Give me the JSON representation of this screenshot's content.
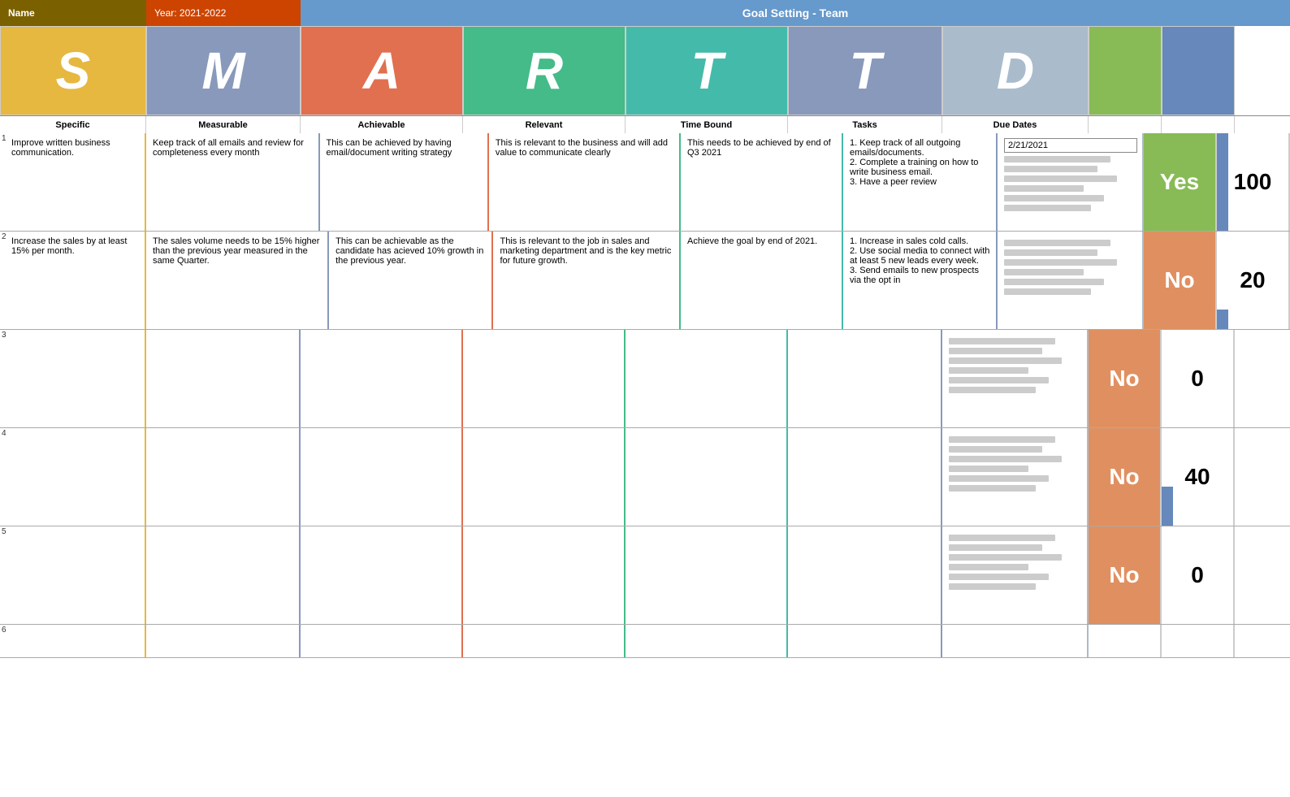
{
  "title": {
    "name_label": "Name",
    "year_label": "Year: 2021-2022",
    "main_title": "Goal Setting - Team"
  },
  "smart_letters": {
    "s": "S",
    "m": "M",
    "a": "A",
    "r": "R",
    "t1": "T",
    "t2": "T",
    "d": "D"
  },
  "col_labels": {
    "specific": "Specific",
    "measurable": "Measurable",
    "achievable": "Achievable",
    "relevant": "Relevant",
    "timebound": "Time Bound",
    "tasks": "Tasks",
    "duedates": "Due Dates",
    "yesno": "",
    "score": ""
  },
  "rows": [
    {
      "num": "1",
      "specific": "Improve written business communication.",
      "measurable": "Keep track of all emails and review for completeness every month",
      "achievable": "This can be achieved by having email/document writing strategy",
      "relevant": "This is relevant to the business and will add value to communicate clearly",
      "timebound": "This needs to be achieved by end of Q3 2021",
      "tasks": "1. Keep track of all outgoing emails/documents.\n2. Complete a training on how to write business email.\n3. Have a peer review",
      "due_date": "2/21/2021",
      "yesno": "Yes",
      "score": "100",
      "score_pct": 100
    },
    {
      "num": "2",
      "specific": "Increase the sales by at least 15% per month.",
      "measurable": "The sales volume needs to be 15% higher than the previous year measured in the same Quarter.",
      "achievable": "This can be achievable as the candidate has acieved 10% growth in the previous year.",
      "relevant": "This is relevant to the job in sales and marketing department and is the key metric for future growth.",
      "timebound": "Achieve the goal by end of 2021.",
      "tasks": "1. Increase in sales cold calls.\n2. Use social media to connect with at least 5 new leads every week.\n3. Send emails to new prospects via the opt in",
      "due_date": "",
      "yesno": "No",
      "score": "20",
      "score_pct": 20
    },
    {
      "num": "3",
      "specific": "",
      "measurable": "",
      "achievable": "",
      "relevant": "",
      "timebound": "",
      "tasks": "",
      "due_date": "",
      "yesno": "No",
      "score": "0",
      "score_pct": 0
    },
    {
      "num": "4",
      "specific": "",
      "measurable": "",
      "achievable": "",
      "relevant": "",
      "timebound": "",
      "tasks": "",
      "due_date": "",
      "yesno": "No",
      "score": "40",
      "score_pct": 40
    },
    {
      "num": "5",
      "specific": "",
      "measurable": "",
      "achievable": "",
      "relevant": "",
      "timebound": "",
      "tasks": "",
      "due_date": "",
      "yesno": "No",
      "score": "0",
      "score_pct": 0
    }
  ]
}
